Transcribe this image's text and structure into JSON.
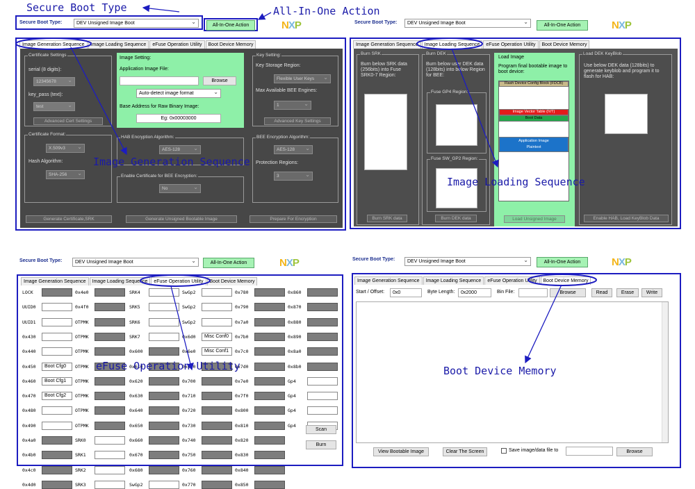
{
  "annotations": {
    "secure_boot_type": "Secure Boot Type",
    "all_in_one_action": "All-In-One Action",
    "image_generation_sequence": "Image Generation Sequence",
    "image_loading_sequence": "Image Loading Sequence",
    "efuse_operation_utility": "eFuse Operation Utility",
    "boot_device_memory": "Boot Device Memory"
  },
  "header": {
    "secure_boot_type_label": "Secure Boot Type:",
    "secure_boot_type_value": "DEV Unsigned Image Boot",
    "all_in_one_button": "All-In-One Action",
    "logo_text": "NXP"
  },
  "tabs": [
    "Image Generation Sequence",
    "Image Loading Sequence",
    "eFuse Operation Utility",
    "Boot Device Memory"
  ],
  "image_generation": {
    "certificate_settings": {
      "title": "Certificate Settings",
      "serial_label": "serial (8 digits):",
      "serial_value": "12345678",
      "key_pass_label": "key_pass (text):",
      "key_pass_value": "test",
      "advanced_button": "Advanced Cert Settings"
    },
    "image_setting": {
      "title": "Image Setting:",
      "app_file_label": "Application Image File:",
      "browse_button": "Browse",
      "format_value": "Auto-detect image format",
      "base_addr_label": "Base Address for Raw Binary Image:",
      "base_addr_placeholder": "Eg: 0x00003000"
    },
    "key_setting": {
      "title": "Key Setting:",
      "storage_label": "Key Storage Region:",
      "storage_value": "Flexible User Keys",
      "max_engine_label": "Max Available BEE Engines:",
      "max_engine_value": "1",
      "advanced_button": "Advanced Key Settings"
    },
    "certificate_format": {
      "title": "Certificate Format:",
      "format_value": "X.509v3",
      "hash_label": "Hash Algorithm:",
      "hash_value": "SHA-256"
    },
    "hab_encryption": {
      "title": "HAB Encryption Algorithm:",
      "value": "AES-128"
    },
    "enable_cert_bee": {
      "title": "Enable Certificate for BEE Encryption:",
      "value": "No"
    },
    "bee_encryption": {
      "title": "BEE Encryption Algorithm:",
      "value": "AES-128",
      "protection_label": "Protection Regions:",
      "protection_value": "3"
    },
    "buttons": {
      "generate_cert": "Generate Certificate,SRK",
      "generate_image": "Generate Unsigned Bootable Image",
      "prepare_encryption": "Prepare For Encryption"
    }
  },
  "image_loading": {
    "burn_srk": {
      "title": "Burn SRK",
      "text": "Burn below SRK data (256bits) into Fuse SRK0-7 Region:",
      "button": "Burn SRK data"
    },
    "burn_dek": {
      "title": "Burn DEK",
      "text": "Burn below user DEK data (128bits) into below Region for BEE:",
      "gp4_title": "Fuse GP4 Region:",
      "swgp2_title": "Fuse SW_GP2 Region:",
      "button": "Burn DEK data"
    },
    "load_image": {
      "title": "Load Image",
      "text": "Program final bootable image to boot device:",
      "blocks": {
        "fcb": "Flash Device Config Block (FDCB)",
        "ivt": "Image Vector Table (IVT)",
        "boot_data": "Boot Data",
        "app_image": "Application Image",
        "plaintext": "Plaintext"
      },
      "button": "Load Unsigned Image"
    },
    "load_dek_keyblob": {
      "title": "Load DEK KeyBlob",
      "text": "Use below DEK data (128bits) to generate keyblob and program it to flash for HAB:",
      "button": "Enable HAB, Load KeyBlob Data"
    }
  },
  "efuse": {
    "columns": [
      [
        {
          "label": "LOCK",
          "field": "gray"
        },
        {
          "label": "UUID0",
          "field": "white"
        },
        {
          "label": "UUID1",
          "field": "white"
        },
        {
          "label": "0x430",
          "field": "white"
        },
        {
          "label": "0x440",
          "field": "white"
        },
        {
          "label": "0x450",
          "field": "white",
          "value": "Boot Cfg0"
        },
        {
          "label": "0x460",
          "field": "white",
          "value": "Boot Cfg1"
        },
        {
          "label": "0x470",
          "field": "white",
          "value": "Boot Cfg2"
        },
        {
          "label": "0x480",
          "field": "white"
        },
        {
          "label": "0x490",
          "field": "white"
        },
        {
          "label": "0x4a0",
          "field": "gray"
        },
        {
          "label": "0x4b0",
          "field": "gray"
        },
        {
          "label": "0x4c0",
          "field": "gray"
        },
        {
          "label": "0x4d0",
          "field": "gray"
        }
      ],
      [
        {
          "label": "0x4e0",
          "field": "gray"
        },
        {
          "label": "0x4f0",
          "field": "gray"
        },
        {
          "label": "OTPMK",
          "field": "gray"
        },
        {
          "label": "OTPMK",
          "field": "gray"
        },
        {
          "label": "OTPMK",
          "field": "gray"
        },
        {
          "label": "OTPMK",
          "field": "gray"
        },
        {
          "label": "OTPMK",
          "field": "gray"
        },
        {
          "label": "OTPMK",
          "field": "gray"
        },
        {
          "label": "OTPMK",
          "field": "gray"
        },
        {
          "label": "OTPMK",
          "field": "gray"
        },
        {
          "label": "SRK0",
          "field": "white"
        },
        {
          "label": "SRK1",
          "field": "white"
        },
        {
          "label": "SRK2",
          "field": "white"
        },
        {
          "label": "SRK3",
          "field": "white"
        }
      ],
      [
        {
          "label": "SRK4",
          "field": "white"
        },
        {
          "label": "SRK5",
          "field": "white"
        },
        {
          "label": "SRK6",
          "field": "white"
        },
        {
          "label": "SRK7",
          "field": "white"
        },
        {
          "label": "0x600",
          "field": "gray"
        },
        {
          "label": "0x610",
          "field": "gray"
        },
        {
          "label": "0x620",
          "field": "gray"
        },
        {
          "label": "0x630",
          "field": "gray"
        },
        {
          "label": "0x640",
          "field": "gray"
        },
        {
          "label": "0x650",
          "field": "gray"
        },
        {
          "label": "0x660",
          "field": "gray"
        },
        {
          "label": "0x670",
          "field": "gray"
        },
        {
          "label": "0x680",
          "field": "gray"
        },
        {
          "label": "SwGp2",
          "field": "white"
        }
      ],
      [
        {
          "label": "SwGp2",
          "field": "white"
        },
        {
          "label": "SwGp2",
          "field": "white"
        },
        {
          "label": "SwGp2",
          "field": "white"
        },
        {
          "label": "0x6d0",
          "field": "white",
          "value": "Misc Conf0"
        },
        {
          "label": "0x6e0",
          "field": "white",
          "value": "Misc Conf1"
        },
        {
          "label": "0x6f0",
          "field": "gray"
        },
        {
          "label": "0x700",
          "field": "gray"
        },
        {
          "label": "0x710",
          "field": "gray"
        },
        {
          "label": "0x720",
          "field": "gray"
        },
        {
          "label": "0x730",
          "field": "gray"
        },
        {
          "label": "0x740",
          "field": "gray"
        },
        {
          "label": "0x750",
          "field": "gray"
        },
        {
          "label": "0x760",
          "field": "gray"
        },
        {
          "label": "0x770",
          "field": "gray"
        }
      ],
      [
        {
          "label": "0x780",
          "field": "gray"
        },
        {
          "label": "0x790",
          "field": "gray"
        },
        {
          "label": "0x7a0",
          "field": "gray"
        },
        {
          "label": "0x7b0",
          "field": "gray"
        },
        {
          "label": "0x7c0",
          "field": "gray"
        },
        {
          "label": "0x7d0",
          "field": "gray"
        },
        {
          "label": "0x7e0",
          "field": "gray"
        },
        {
          "label": "0x7f0",
          "field": "gray"
        },
        {
          "label": "0x800",
          "field": "gray"
        },
        {
          "label": "0x810",
          "field": "gray"
        },
        {
          "label": "0x820",
          "field": "gray"
        },
        {
          "label": "0x830",
          "field": "gray"
        },
        {
          "label": "0x840",
          "field": "gray"
        },
        {
          "label": "0x850",
          "field": "gray"
        }
      ],
      [
        {
          "label": "0x860",
          "field": "gray"
        },
        {
          "label": "0x870",
          "field": "gray"
        },
        {
          "label": "0x880",
          "field": "gray"
        },
        {
          "label": "0x890",
          "field": "gray"
        },
        {
          "label": "0x8a0",
          "field": "gray"
        },
        {
          "label": "0x8b0",
          "field": "gray"
        },
        {
          "label": "Gp4",
          "field": "white"
        },
        {
          "label": "Gp4",
          "field": "white"
        },
        {
          "label": "Gp4",
          "field": "white"
        },
        {
          "label": "Gp4",
          "field": "white"
        }
      ]
    ],
    "scan_button": "Scan",
    "burn_button": "Burn"
  },
  "boot_memory": {
    "start_label": "Start / Offset:",
    "start_value": "0x0",
    "length_label": "Byte Length:",
    "length_value": "0x2000",
    "bin_label": "Bin File:",
    "browse_button": "Browse",
    "read_button": "Read",
    "erase_button": "Erase",
    "write_button": "Write",
    "view_button": "View Bootable Image",
    "clear_button": "Clear The Screen",
    "save_label": "Save image/data file to",
    "browse2_button": "Browse"
  }
}
